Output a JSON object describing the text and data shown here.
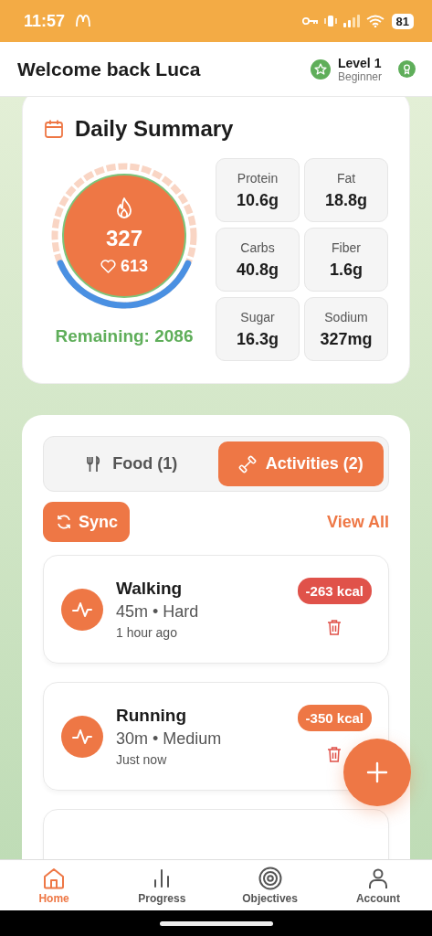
{
  "status_bar": {
    "time": "11:57",
    "battery": "81"
  },
  "header": {
    "greeting": "Welcome back Luca",
    "level": "Level 1",
    "rank": "Beginner"
  },
  "summary": {
    "title": "Daily Summary",
    "calories": "327",
    "burned": "613",
    "remaining": "Remaining: 2086",
    "macros": [
      {
        "label": "Protein",
        "value": "10.6g"
      },
      {
        "label": "Fat",
        "value": "18.8g"
      },
      {
        "label": "Carbs",
        "value": "40.8g"
      },
      {
        "label": "Fiber",
        "value": "1.6g"
      },
      {
        "label": "Sugar",
        "value": "16.3g"
      },
      {
        "label": "Sodium",
        "value": "327mg"
      }
    ]
  },
  "tabs": [
    {
      "label": "Food (1)",
      "kind": "food",
      "selected": false
    },
    {
      "label": "Activities (2)",
      "kind": "activity",
      "selected": true
    }
  ],
  "sync_button": "Sync",
  "view_all": "View All",
  "activities": [
    {
      "name": "Walking",
      "detail": "45m • Hard",
      "time": "1 hour ago",
      "calories": "-263 kcal",
      "color": "#e0524a"
    },
    {
      "name": "Running",
      "detail": "30m • Medium",
      "time": "Just now",
      "calories": "-350 kcal",
      "color": "#ee7745"
    }
  ],
  "nav": [
    {
      "label": "Home",
      "kind": "home",
      "selected": true
    },
    {
      "label": "Progress",
      "kind": "progress",
      "selected": false
    },
    {
      "label": "Objectives",
      "kind": "objectives",
      "selected": false
    },
    {
      "label": "Account",
      "kind": "account",
      "selected": false
    }
  ]
}
